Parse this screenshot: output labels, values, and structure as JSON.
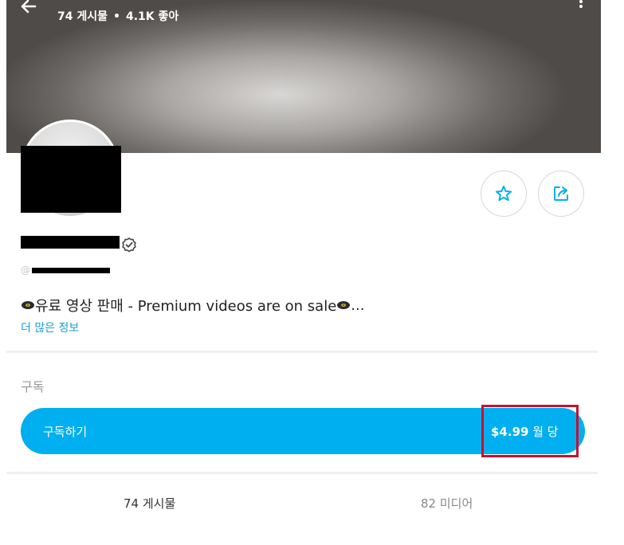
{
  "header": {
    "posts_stat": "74 게시물",
    "likes_stat": "4.1K 좋아"
  },
  "profile": {
    "handle_prefix": "@",
    "bio": "유료 영상 판매 - Premium videos are on sale",
    "bio_ellipsis": "...",
    "more_info": "더 많은 정보"
  },
  "subscription": {
    "heading": "구독",
    "button_label": "구독하기",
    "price": "$4.99",
    "price_suffix": "월 당"
  },
  "tabs": {
    "posts": "74 게시물",
    "media": "82 미디어"
  },
  "colors": {
    "accent": "#00aff0",
    "link": "#1a9ed6",
    "highlight_box": "#c8102e"
  }
}
